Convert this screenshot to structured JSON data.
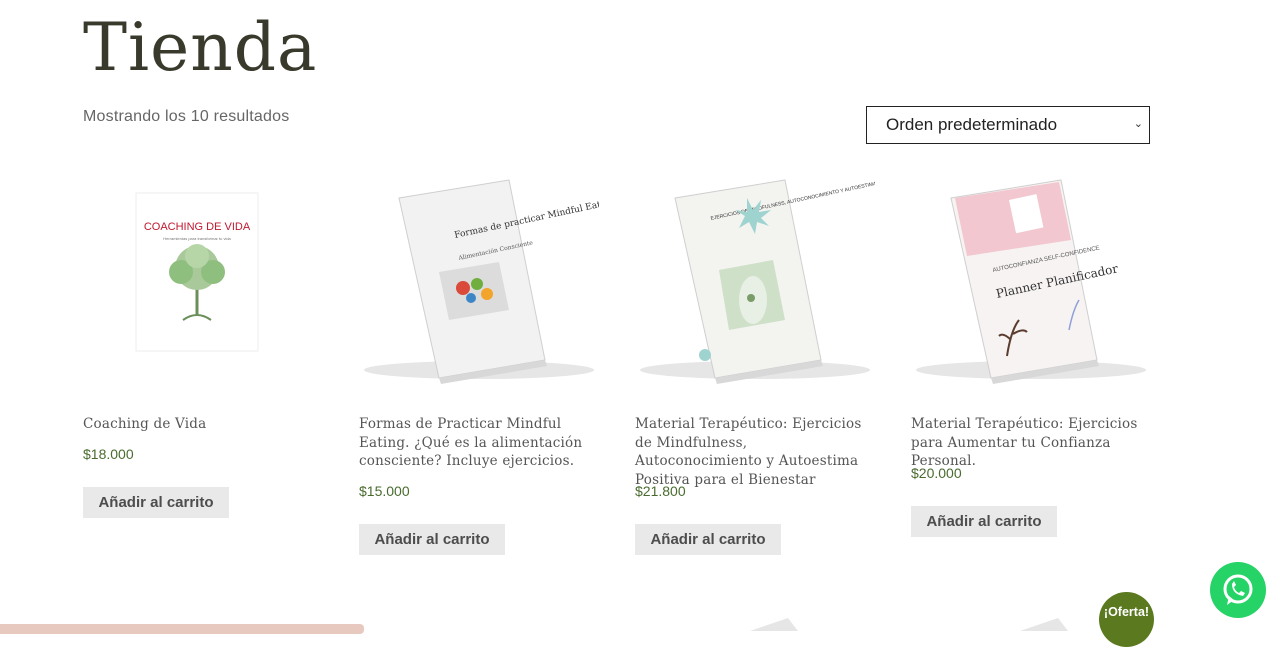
{
  "page": {
    "title": "Tienda",
    "results_text": "Mostrando los 10 resultados"
  },
  "sort": {
    "selected": "Orden predeterminado"
  },
  "products": [
    {
      "title": "Coaching de Vida",
      "price": "$18.000",
      "button": "Añadir al carrito",
      "cover_title": "COACHING DE VIDA",
      "cover_subtitle": "Herramientas para transformar tu vida"
    },
    {
      "title": "Formas de Practicar Mindful Eating. ¿Qué es la alimentación consciente? Incluye ejercicios.",
      "price": "$15.000",
      "button": "Añadir al carrito",
      "cover_title": "Formas de practicar Mindful Eating",
      "cover_subtitle": "Alimentación Consciente"
    },
    {
      "title": "Material Terapéutico: Ejercicios de Mindfulness, Autoconocimiento y Autoestima Positiva para el Bienestar",
      "price": "$21.800",
      "button": "Añadir al carrito",
      "cover_title": "EJERCICIOS DE MINDFULNESS, AUTOCONOCIMIENTO Y AUTOESTIMA POSITIVA PARA EL BIENESTAR"
    },
    {
      "title": "Material Terapéutico: Ejercicios para Aumentar tu Confianza Personal.",
      "price": "$20.000",
      "button": "Añadir al carrito",
      "cover_title": "AUTOCONFIANZA SELF-CONFIDENCE",
      "cover_subtitle": "Planner Planificador"
    }
  ],
  "badge": {
    "sale": "¡Oferta!"
  },
  "colors": {
    "price": "#4a6b2f",
    "whatsapp": "#25d366",
    "sale_badge": "#5b7a1f",
    "button_bg": "#e9e9e9"
  }
}
